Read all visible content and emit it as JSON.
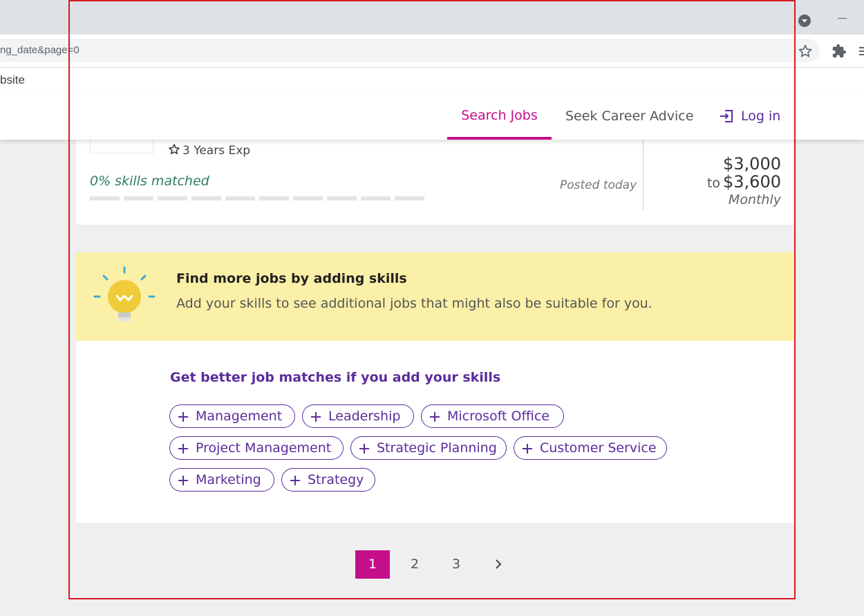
{
  "browser": {
    "url_text": "ng_date&page=0",
    "bookmark_label": "bsite",
    "icons": [
      "profile-icon",
      "minimize-icon",
      "bookmark-star-icon",
      "extensions-icon",
      "menu-icon"
    ]
  },
  "header": {
    "nav": {
      "search_jobs": "Search Jobs",
      "career_advice": "Seek Career Advice",
      "login": "Log in"
    },
    "active_color": "#c40e8a",
    "brand_color": "#5b2c9c"
  },
  "job_card": {
    "experience": "3 Years Exp",
    "skills_matched": "0% skills matched",
    "skill_match_fraction": 0,
    "posted": "Posted today",
    "salary": {
      "from": "$3,000",
      "to_prefix": "to",
      "to": "$3,600",
      "period": "Monthly"
    }
  },
  "banner": {
    "title": "Find more jobs by adding skills",
    "description": "Add your skills to see additional jobs that might also be suitable for you.",
    "icon": "lightbulb-icon"
  },
  "skills": {
    "heading": "Get better job matches if you add your skills",
    "chips": [
      "Management",
      "Leadership",
      "Microsoft Office",
      "Project Management",
      "Strategic Planning",
      "Customer Service",
      "Marketing",
      "Strategy"
    ]
  },
  "pagination": {
    "pages": [
      "1",
      "2",
      "3"
    ],
    "current": "1",
    "next_icon": "chevron-right-icon"
  }
}
